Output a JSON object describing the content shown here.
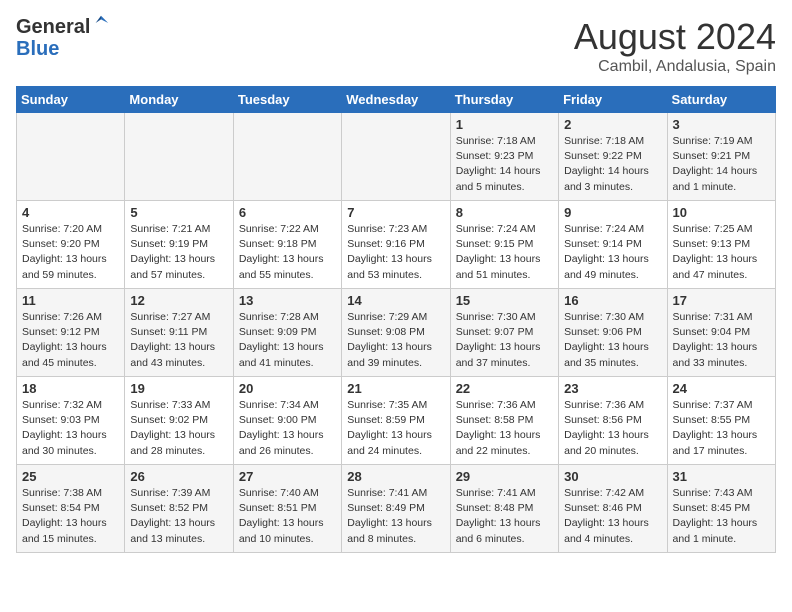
{
  "header": {
    "logo_general": "General",
    "logo_blue": "Blue",
    "month_title": "August 2024",
    "location": "Cambil, Andalusia, Spain"
  },
  "weekdays": [
    "Sunday",
    "Monday",
    "Tuesday",
    "Wednesday",
    "Thursday",
    "Friday",
    "Saturday"
  ],
  "weeks": [
    [
      {
        "day": "",
        "info": ""
      },
      {
        "day": "",
        "info": ""
      },
      {
        "day": "",
        "info": ""
      },
      {
        "day": "",
        "info": ""
      },
      {
        "day": "1",
        "info": "Sunrise: 7:18 AM\nSunset: 9:23 PM\nDaylight: 14 hours\nand 5 minutes."
      },
      {
        "day": "2",
        "info": "Sunrise: 7:18 AM\nSunset: 9:22 PM\nDaylight: 14 hours\nand 3 minutes."
      },
      {
        "day": "3",
        "info": "Sunrise: 7:19 AM\nSunset: 9:21 PM\nDaylight: 14 hours\nand 1 minute."
      }
    ],
    [
      {
        "day": "4",
        "info": "Sunrise: 7:20 AM\nSunset: 9:20 PM\nDaylight: 13 hours\nand 59 minutes."
      },
      {
        "day": "5",
        "info": "Sunrise: 7:21 AM\nSunset: 9:19 PM\nDaylight: 13 hours\nand 57 minutes."
      },
      {
        "day": "6",
        "info": "Sunrise: 7:22 AM\nSunset: 9:18 PM\nDaylight: 13 hours\nand 55 minutes."
      },
      {
        "day": "7",
        "info": "Sunrise: 7:23 AM\nSunset: 9:16 PM\nDaylight: 13 hours\nand 53 minutes."
      },
      {
        "day": "8",
        "info": "Sunrise: 7:24 AM\nSunset: 9:15 PM\nDaylight: 13 hours\nand 51 minutes."
      },
      {
        "day": "9",
        "info": "Sunrise: 7:24 AM\nSunset: 9:14 PM\nDaylight: 13 hours\nand 49 minutes."
      },
      {
        "day": "10",
        "info": "Sunrise: 7:25 AM\nSunset: 9:13 PM\nDaylight: 13 hours\nand 47 minutes."
      }
    ],
    [
      {
        "day": "11",
        "info": "Sunrise: 7:26 AM\nSunset: 9:12 PM\nDaylight: 13 hours\nand 45 minutes."
      },
      {
        "day": "12",
        "info": "Sunrise: 7:27 AM\nSunset: 9:11 PM\nDaylight: 13 hours\nand 43 minutes."
      },
      {
        "day": "13",
        "info": "Sunrise: 7:28 AM\nSunset: 9:09 PM\nDaylight: 13 hours\nand 41 minutes."
      },
      {
        "day": "14",
        "info": "Sunrise: 7:29 AM\nSunset: 9:08 PM\nDaylight: 13 hours\nand 39 minutes."
      },
      {
        "day": "15",
        "info": "Sunrise: 7:30 AM\nSunset: 9:07 PM\nDaylight: 13 hours\nand 37 minutes."
      },
      {
        "day": "16",
        "info": "Sunrise: 7:30 AM\nSunset: 9:06 PM\nDaylight: 13 hours\nand 35 minutes."
      },
      {
        "day": "17",
        "info": "Sunrise: 7:31 AM\nSunset: 9:04 PM\nDaylight: 13 hours\nand 33 minutes."
      }
    ],
    [
      {
        "day": "18",
        "info": "Sunrise: 7:32 AM\nSunset: 9:03 PM\nDaylight: 13 hours\nand 30 minutes."
      },
      {
        "day": "19",
        "info": "Sunrise: 7:33 AM\nSunset: 9:02 PM\nDaylight: 13 hours\nand 28 minutes."
      },
      {
        "day": "20",
        "info": "Sunrise: 7:34 AM\nSunset: 9:00 PM\nDaylight: 13 hours\nand 26 minutes."
      },
      {
        "day": "21",
        "info": "Sunrise: 7:35 AM\nSunset: 8:59 PM\nDaylight: 13 hours\nand 24 minutes."
      },
      {
        "day": "22",
        "info": "Sunrise: 7:36 AM\nSunset: 8:58 PM\nDaylight: 13 hours\nand 22 minutes."
      },
      {
        "day": "23",
        "info": "Sunrise: 7:36 AM\nSunset: 8:56 PM\nDaylight: 13 hours\nand 20 minutes."
      },
      {
        "day": "24",
        "info": "Sunrise: 7:37 AM\nSunset: 8:55 PM\nDaylight: 13 hours\nand 17 minutes."
      }
    ],
    [
      {
        "day": "25",
        "info": "Sunrise: 7:38 AM\nSunset: 8:54 PM\nDaylight: 13 hours\nand 15 minutes."
      },
      {
        "day": "26",
        "info": "Sunrise: 7:39 AM\nSunset: 8:52 PM\nDaylight: 13 hours\nand 13 minutes."
      },
      {
        "day": "27",
        "info": "Sunrise: 7:40 AM\nSunset: 8:51 PM\nDaylight: 13 hours\nand 10 minutes."
      },
      {
        "day": "28",
        "info": "Sunrise: 7:41 AM\nSunset: 8:49 PM\nDaylight: 13 hours\nand 8 minutes."
      },
      {
        "day": "29",
        "info": "Sunrise: 7:41 AM\nSunset: 8:48 PM\nDaylight: 13 hours\nand 6 minutes."
      },
      {
        "day": "30",
        "info": "Sunrise: 7:42 AM\nSunset: 8:46 PM\nDaylight: 13 hours\nand 4 minutes."
      },
      {
        "day": "31",
        "info": "Sunrise: 7:43 AM\nSunset: 8:45 PM\nDaylight: 13 hours\nand 1 minute."
      }
    ]
  ]
}
